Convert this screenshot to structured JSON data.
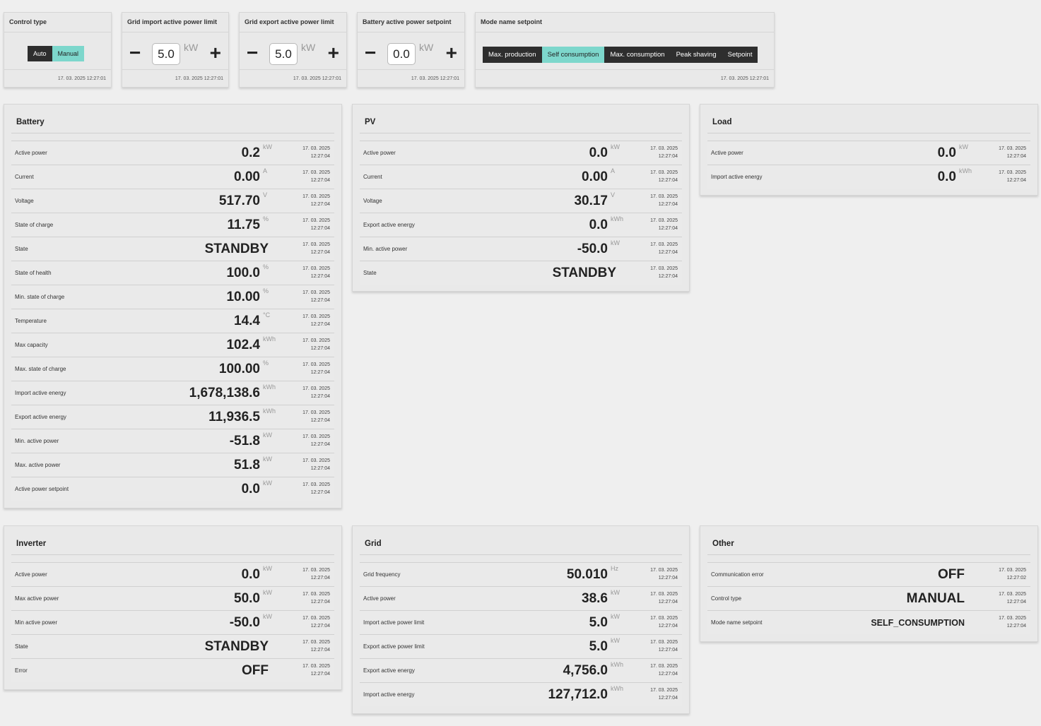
{
  "controls": {
    "control_type": {
      "title": "Control type",
      "options": [
        "Auto",
        "Manual"
      ],
      "selected": "Manual",
      "timestamp": "17. 03. 2025 12:27:01"
    },
    "grid_import": {
      "title": "Grid import active power limit",
      "value": "5.0",
      "unit": "kW",
      "timestamp": "17. 03. 2025 12:27:01"
    },
    "grid_export": {
      "title": "Grid export active power limit",
      "value": "5.0",
      "unit": "kW",
      "timestamp": "17. 03. 2025 12:27:01"
    },
    "battery_setpoint": {
      "title": "Battery active power setpoint",
      "value": "0.0",
      "unit": "kW",
      "timestamp": "17. 03. 2025 12:27:01"
    },
    "mode": {
      "title": "Mode name setpoint",
      "options": [
        "Max. production",
        "Self consumption",
        "Max. consumption",
        "Peak shaving",
        "Setpoint"
      ],
      "selected": "Self consumption",
      "timestamp": "17. 03. 2025 12:27:01"
    }
  },
  "panels": {
    "battery": {
      "title": "Battery",
      "rows": [
        {
          "label": "Active power",
          "value": "0.2",
          "unit": "kW",
          "date": "17. 03. 2025",
          "time": "12:27:04"
        },
        {
          "label": "Current",
          "value": "0.00",
          "unit": "A",
          "date": "17. 03. 2025",
          "time": "12:27:04"
        },
        {
          "label": "Voltage",
          "value": "517.70",
          "unit": "V",
          "date": "17. 03. 2025",
          "time": "12:27:04"
        },
        {
          "label": "State of charge",
          "value": "11.75",
          "unit": "%",
          "date": "17. 03. 2025",
          "time": "12:27:04"
        },
        {
          "label": "State",
          "value": "STANDBY",
          "unit": "",
          "date": "17. 03. 2025",
          "time": "12:27:04"
        },
        {
          "label": "State of health",
          "value": "100.0",
          "unit": "%",
          "date": "17. 03. 2025",
          "time": "12:27:04"
        },
        {
          "label": "Min. state of charge",
          "value": "10.00",
          "unit": "%",
          "date": "17. 03. 2025",
          "time": "12:27:04"
        },
        {
          "label": "Temperature",
          "value": "14.4",
          "unit": "°C",
          "date": "17. 03. 2025",
          "time": "12:27:04"
        },
        {
          "label": "Max capacity",
          "value": "102.4",
          "unit": "kWh",
          "date": "17. 03. 2025",
          "time": "12:27:04"
        },
        {
          "label": "Max. state of charge",
          "value": "100.00",
          "unit": "%",
          "date": "17. 03. 2025",
          "time": "12:27:04"
        },
        {
          "label": "Import active energy",
          "value": "1,678,138.6",
          "unit": "kWh",
          "date": "17. 03. 2025",
          "time": "12:27:04"
        },
        {
          "label": "Export active energy",
          "value": "11,936.5",
          "unit": "kWh",
          "date": "17. 03. 2025",
          "time": "12:27:04"
        },
        {
          "label": "Min. active power",
          "value": "-51.8",
          "unit": "kW",
          "date": "17. 03. 2025",
          "time": "12:27:04"
        },
        {
          "label": "Max. active power",
          "value": "51.8",
          "unit": "kW",
          "date": "17. 03. 2025",
          "time": "12:27:04"
        },
        {
          "label": "Active power setpoint",
          "value": "0.0",
          "unit": "kW",
          "date": "17. 03. 2025",
          "time": "12:27:04"
        }
      ]
    },
    "pv": {
      "title": "PV",
      "rows": [
        {
          "label": "Active power",
          "value": "0.0",
          "unit": "kW",
          "date": "17. 03. 2025",
          "time": "12:27:04"
        },
        {
          "label": "Current",
          "value": "0.00",
          "unit": "A",
          "date": "17. 03. 2025",
          "time": "12:27:04"
        },
        {
          "label": "Voltage",
          "value": "30.17",
          "unit": "V",
          "date": "17. 03. 2025",
          "time": "12:27:04"
        },
        {
          "label": "Export active energy",
          "value": "0.0",
          "unit": "kWh",
          "date": "17. 03. 2025",
          "time": "12:27:04"
        },
        {
          "label": "Min. active power",
          "value": "-50.0",
          "unit": "kW",
          "date": "17. 03. 2025",
          "time": "12:27:04"
        },
        {
          "label": "State",
          "value": "STANDBY",
          "unit": "",
          "date": "17. 03. 2025",
          "time": "12:27:04"
        }
      ]
    },
    "load": {
      "title": "Load",
      "rows": [
        {
          "label": "Active power",
          "value": "0.0",
          "unit": "kW",
          "date": "17. 03. 2025",
          "time": "12:27:04"
        },
        {
          "label": "Import active energy",
          "value": "0.0",
          "unit": "kWh",
          "date": "17. 03. 2025",
          "time": "12:27:04"
        }
      ]
    },
    "inverter": {
      "title": "Inverter",
      "rows": [
        {
          "label": "Active power",
          "value": "0.0",
          "unit": "kW",
          "date": "17. 03. 2025",
          "time": "12:27:04"
        },
        {
          "label": "Max active power",
          "value": "50.0",
          "unit": "kW",
          "date": "17. 03. 2025",
          "time": "12:27:04"
        },
        {
          "label": "Min active power",
          "value": "-50.0",
          "unit": "kW",
          "date": "17. 03. 2025",
          "time": "12:27:04"
        },
        {
          "label": "State",
          "value": "STANDBY",
          "unit": "",
          "date": "17. 03. 2025",
          "time": "12:27:04"
        },
        {
          "label": "Error",
          "value": "OFF",
          "unit": "",
          "date": "17. 03. 2025",
          "time": "12:27:04"
        }
      ]
    },
    "grid": {
      "title": "Grid",
      "rows": [
        {
          "label": "Grid frequency",
          "value": "50.010",
          "unit": "Hz",
          "date": "17. 03. 2025",
          "time": "12:27:04"
        },
        {
          "label": "Active power",
          "value": "38.6",
          "unit": "kW",
          "date": "17. 03. 2025",
          "time": "12:27:04"
        },
        {
          "label": "Import active power limit",
          "value": "5.0",
          "unit": "kW",
          "date": "17. 03. 2025",
          "time": "12:27:04"
        },
        {
          "label": "Export active power limit",
          "value": "5.0",
          "unit": "kW",
          "date": "17. 03. 2025",
          "time": "12:27:04"
        },
        {
          "label": "Export active energy",
          "value": "4,756.0",
          "unit": "kWh",
          "date": "17. 03. 2025",
          "time": "12:27:04"
        },
        {
          "label": "Import active energy",
          "value": "127,712.0",
          "unit": "kWh",
          "date": "17. 03. 2025",
          "time": "12:27:04"
        }
      ]
    },
    "other": {
      "title": "Other",
      "rows": [
        {
          "label": "Communication error",
          "value": "OFF",
          "unit": "",
          "date": "17. 03. 2025",
          "time": "12:27:02"
        },
        {
          "label": "Control type",
          "value": "MANUAL",
          "unit": "",
          "date": "17. 03. 2025",
          "time": "12:27:04"
        },
        {
          "label": "Mode name setpoint",
          "value": "SELF_CONSUMPTION",
          "unit": "",
          "date": "17. 03. 2025",
          "time": "12:27:04"
        }
      ]
    }
  }
}
